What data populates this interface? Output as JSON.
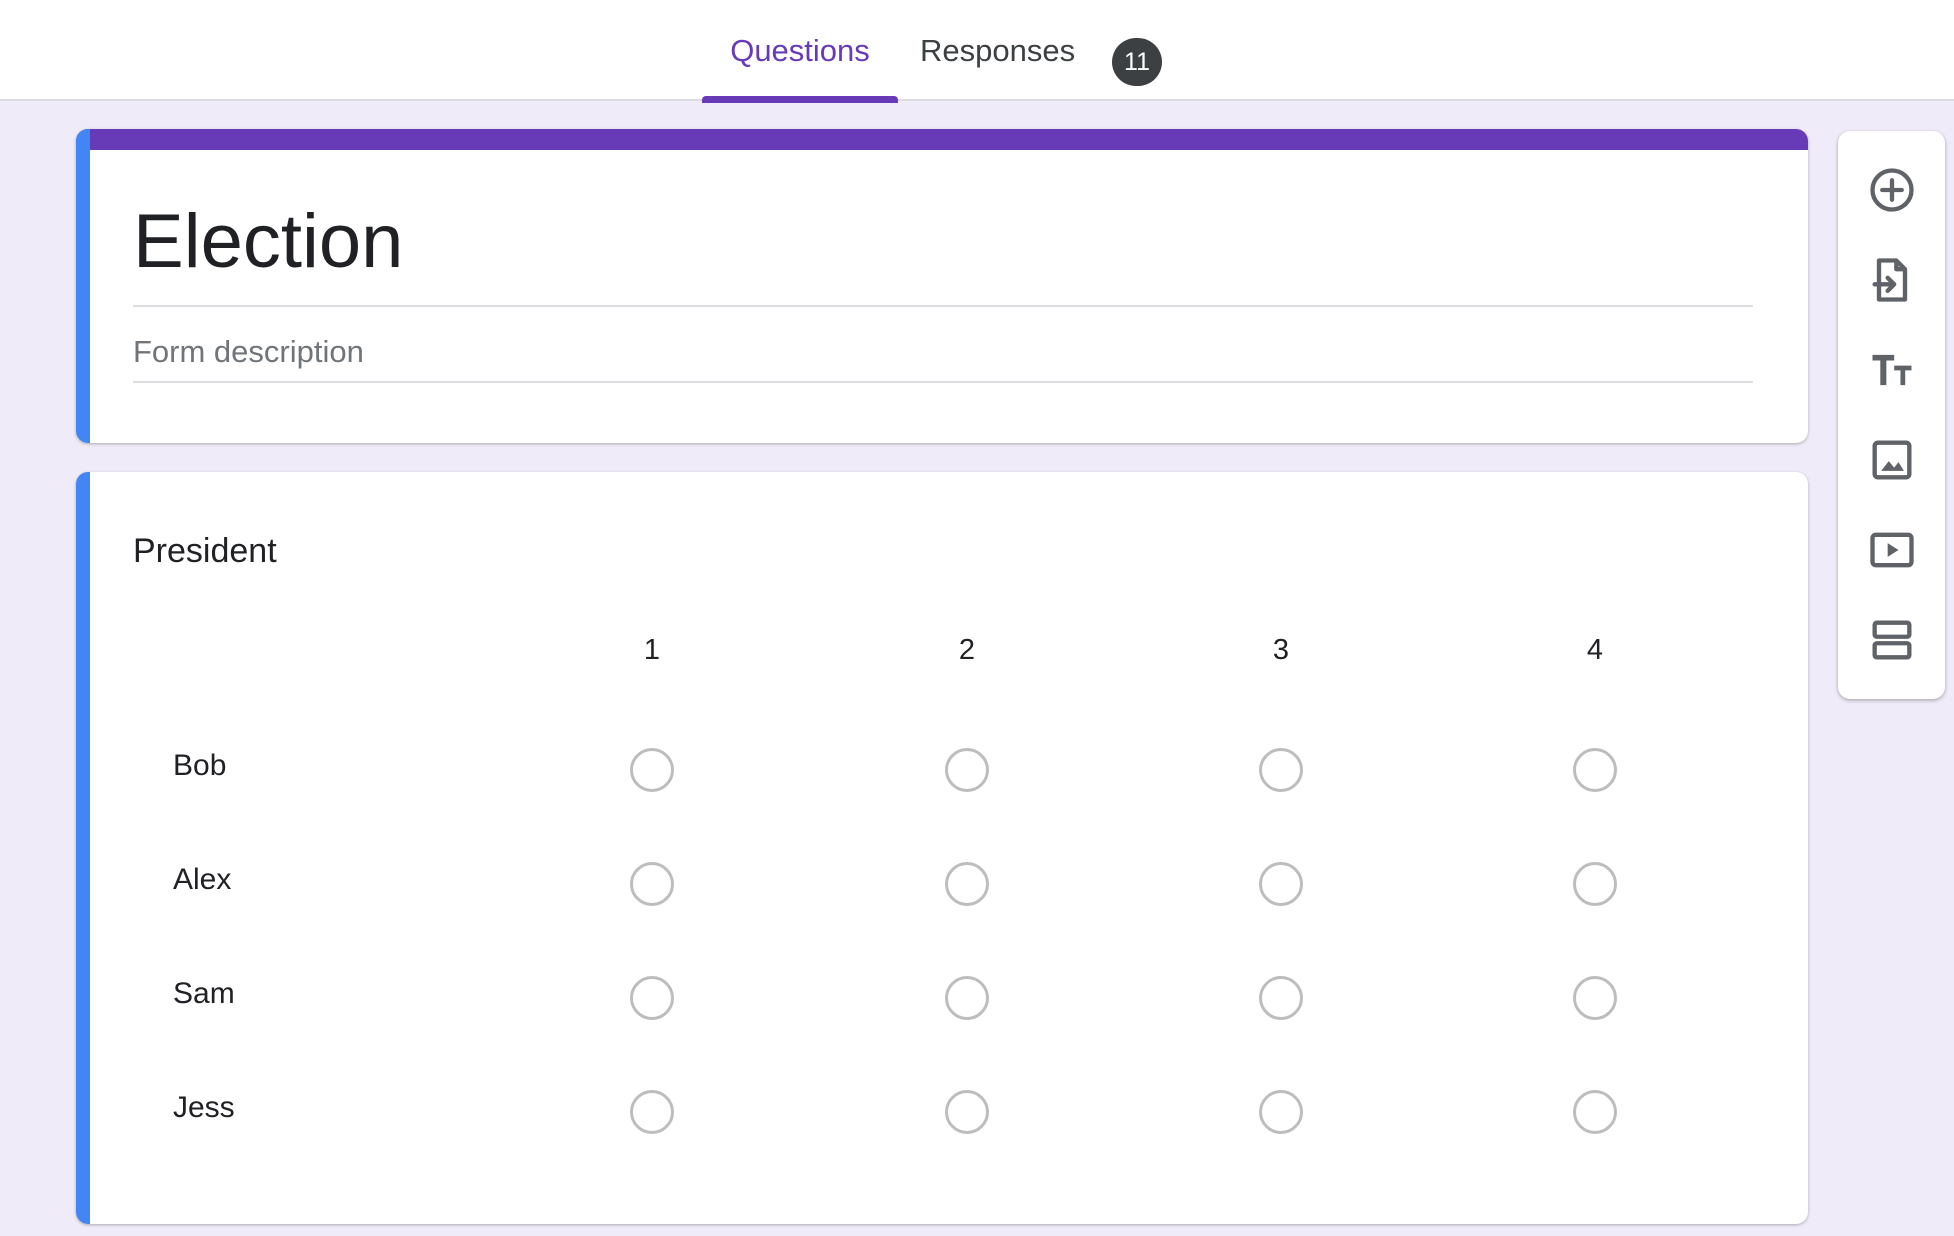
{
  "tabs": {
    "questions_label": "Questions",
    "responses_label": "Responses",
    "responses_count": "11",
    "accent_color": "#673ab7"
  },
  "form": {
    "title": "Election",
    "description_placeholder": "Form description",
    "header_color": "#673ab7"
  },
  "question": {
    "title": "President",
    "columns": [
      "1",
      "2",
      "3",
      "4"
    ],
    "rows": [
      "Bob",
      "Alex",
      "Sam",
      "Jess"
    ]
  },
  "toolbar": {
    "icons": [
      "add-question-icon",
      "import-questions-icon",
      "add-title-icon",
      "add-image-icon",
      "add-video-icon",
      "add-section-icon"
    ]
  }
}
